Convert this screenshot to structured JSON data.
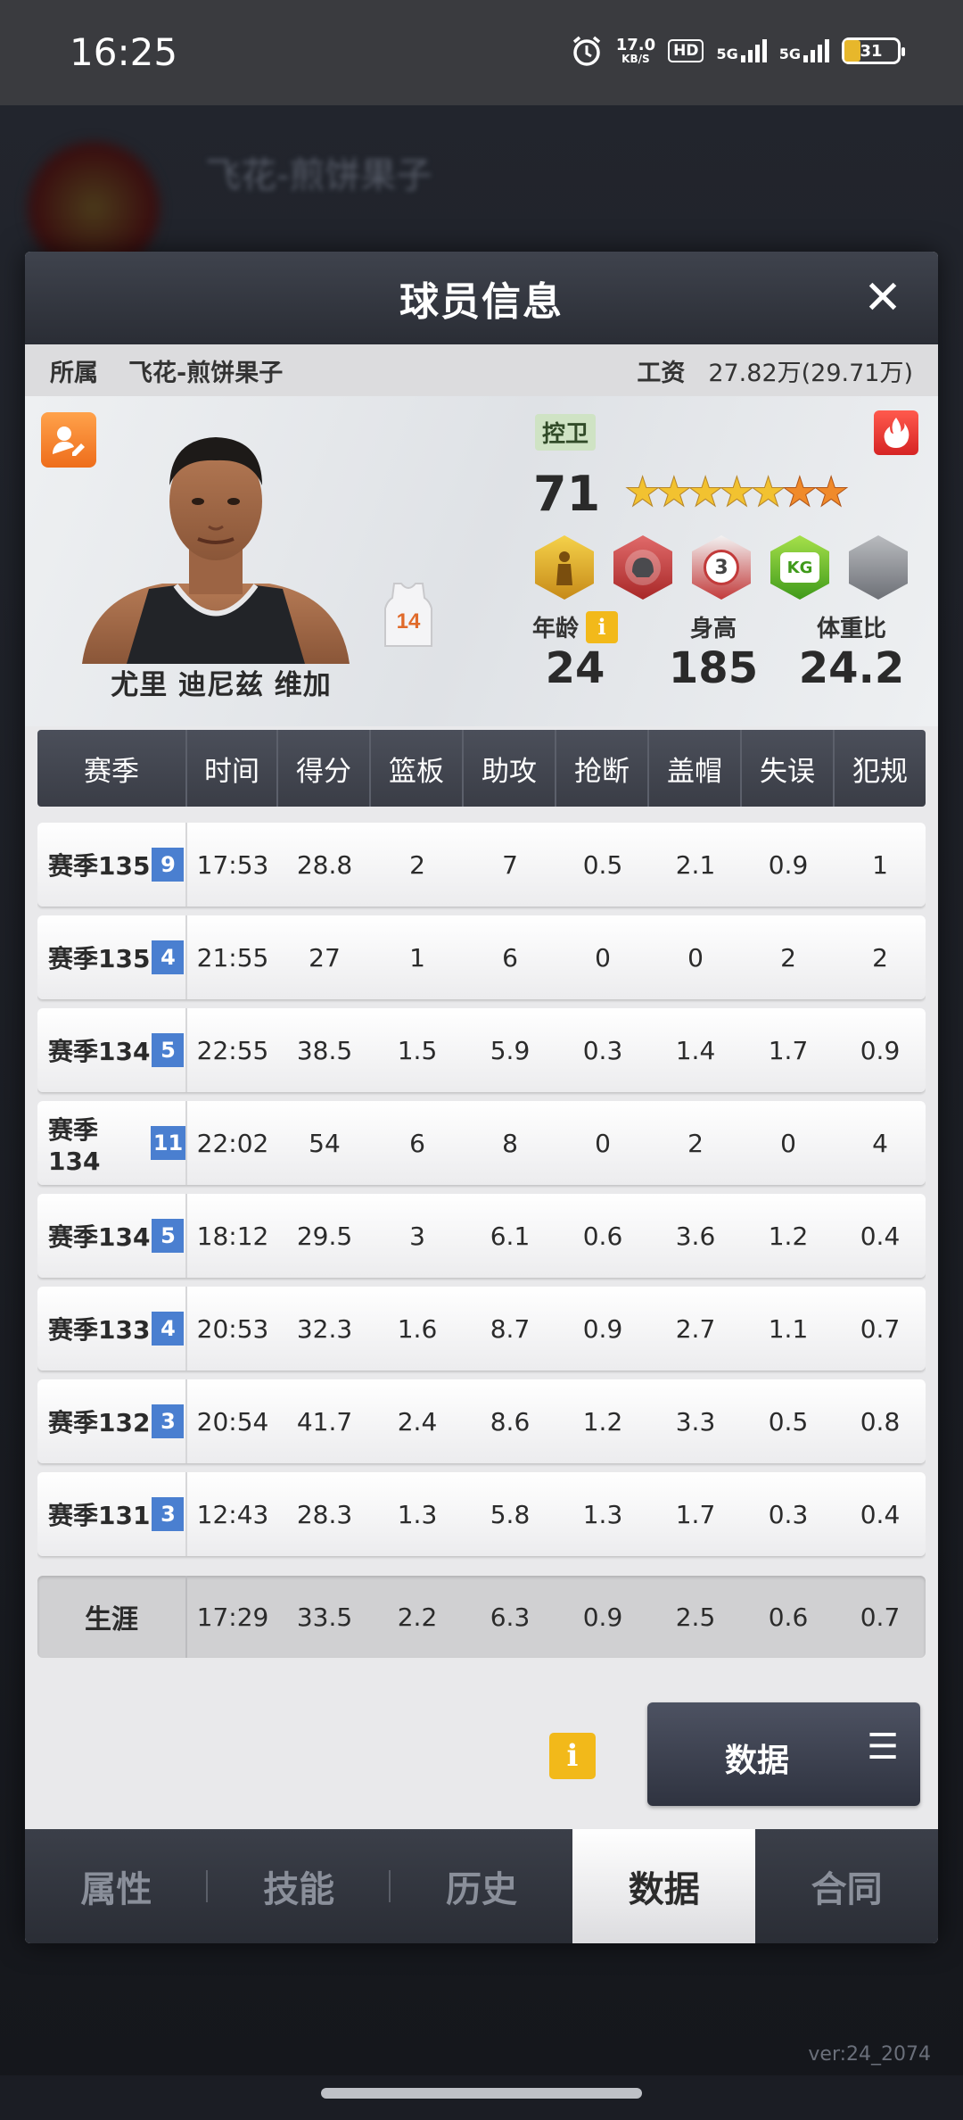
{
  "status": {
    "time": "16:25",
    "net_speed": "17.0",
    "net_unit": "KB/S",
    "hd": "HD",
    "sig1": "5G",
    "sig2": "5G",
    "battery": "31"
  },
  "background": {
    "team_title": "飞花-煎饼果子",
    "version": "ver:24_2074"
  },
  "modal": {
    "title": "球员信息",
    "close": "✕"
  },
  "team": {
    "label": "所属",
    "name": "飞花-煎饼果子",
    "salary_label": "工资",
    "salary_value": "27.82万(29.71万)"
  },
  "player": {
    "name": "尤里 迪尼兹 维加",
    "jersey_number": "14",
    "position": "控卫",
    "rating": "71",
    "stars_gold": 5,
    "stars_orange": 2,
    "badges": [
      "gold-player-badge",
      "red-helmet-badge",
      "three-point-badge",
      "kg-badge",
      "gray-badge"
    ],
    "badge_three": "3",
    "badge_kg": "KG",
    "age_label": "年龄",
    "age": "24",
    "height_label": "身高",
    "height": "185",
    "weight_label": "体重比",
    "weight_ratio": "24.2"
  },
  "table": {
    "headers": [
      "赛季",
      "时间",
      "得分",
      "篮板",
      "助攻",
      "抢断",
      "盖帽",
      "失误",
      "犯规"
    ],
    "rows": [
      {
        "season": "赛季135",
        "n": "9",
        "time": "17:53",
        "pts": "28.8",
        "reb": "2",
        "ast": "7",
        "stl": "0.5",
        "blk": "2.1",
        "tov": "0.9",
        "pf": "1"
      },
      {
        "season": "赛季135",
        "n": "4",
        "time": "21:55",
        "pts": "27",
        "reb": "1",
        "ast": "6",
        "stl": "0",
        "blk": "0",
        "tov": "2",
        "pf": "2"
      },
      {
        "season": "赛季134",
        "n": "5",
        "time": "22:55",
        "pts": "38.5",
        "reb": "1.5",
        "ast": "5.9",
        "stl": "0.3",
        "blk": "1.4",
        "tov": "1.7",
        "pf": "0.9"
      },
      {
        "season": "赛季134",
        "n": "11",
        "time": "22:02",
        "pts": "54",
        "reb": "6",
        "ast": "8",
        "stl": "0",
        "blk": "2",
        "tov": "0",
        "pf": "4"
      },
      {
        "season": "赛季134",
        "n": "5",
        "time": "18:12",
        "pts": "29.5",
        "reb": "3",
        "ast": "6.1",
        "stl": "0.6",
        "blk": "3.6",
        "tov": "1.2",
        "pf": "0.4"
      },
      {
        "season": "赛季133",
        "n": "4",
        "time": "20:53",
        "pts": "32.3",
        "reb": "1.6",
        "ast": "8.7",
        "stl": "0.9",
        "blk": "2.7",
        "tov": "1.1",
        "pf": "0.7"
      },
      {
        "season": "赛季132",
        "n": "3",
        "time": "20:54",
        "pts": "41.7",
        "reb": "2.4",
        "ast": "8.6",
        "stl": "1.2",
        "blk": "3.3",
        "tov": "0.5",
        "pf": "0.8"
      },
      {
        "season": "赛季131",
        "n": "3",
        "time": "12:43",
        "pts": "28.3",
        "reb": "1.3",
        "ast": "5.8",
        "stl": "1.3",
        "blk": "1.7",
        "tov": "0.3",
        "pf": "0.4"
      }
    ],
    "career": {
      "season": "生涯",
      "time": "17:29",
      "pts": "33.5",
      "reb": "2.2",
      "ast": "6.3",
      "stl": "0.9",
      "blk": "2.5",
      "tov": "0.6",
      "pf": "0.7"
    }
  },
  "actions": {
    "info": "i",
    "data_button": "数据",
    "menu_icon": "☰"
  },
  "tabs": [
    "属性",
    "技能",
    "历史",
    "数据",
    "合同"
  ],
  "active_tab": 3,
  "colors": {
    "accent_blue": "#4a7fd0",
    "info_yellow": "#f2b91a",
    "header_dark": "#3a3d46"
  }
}
